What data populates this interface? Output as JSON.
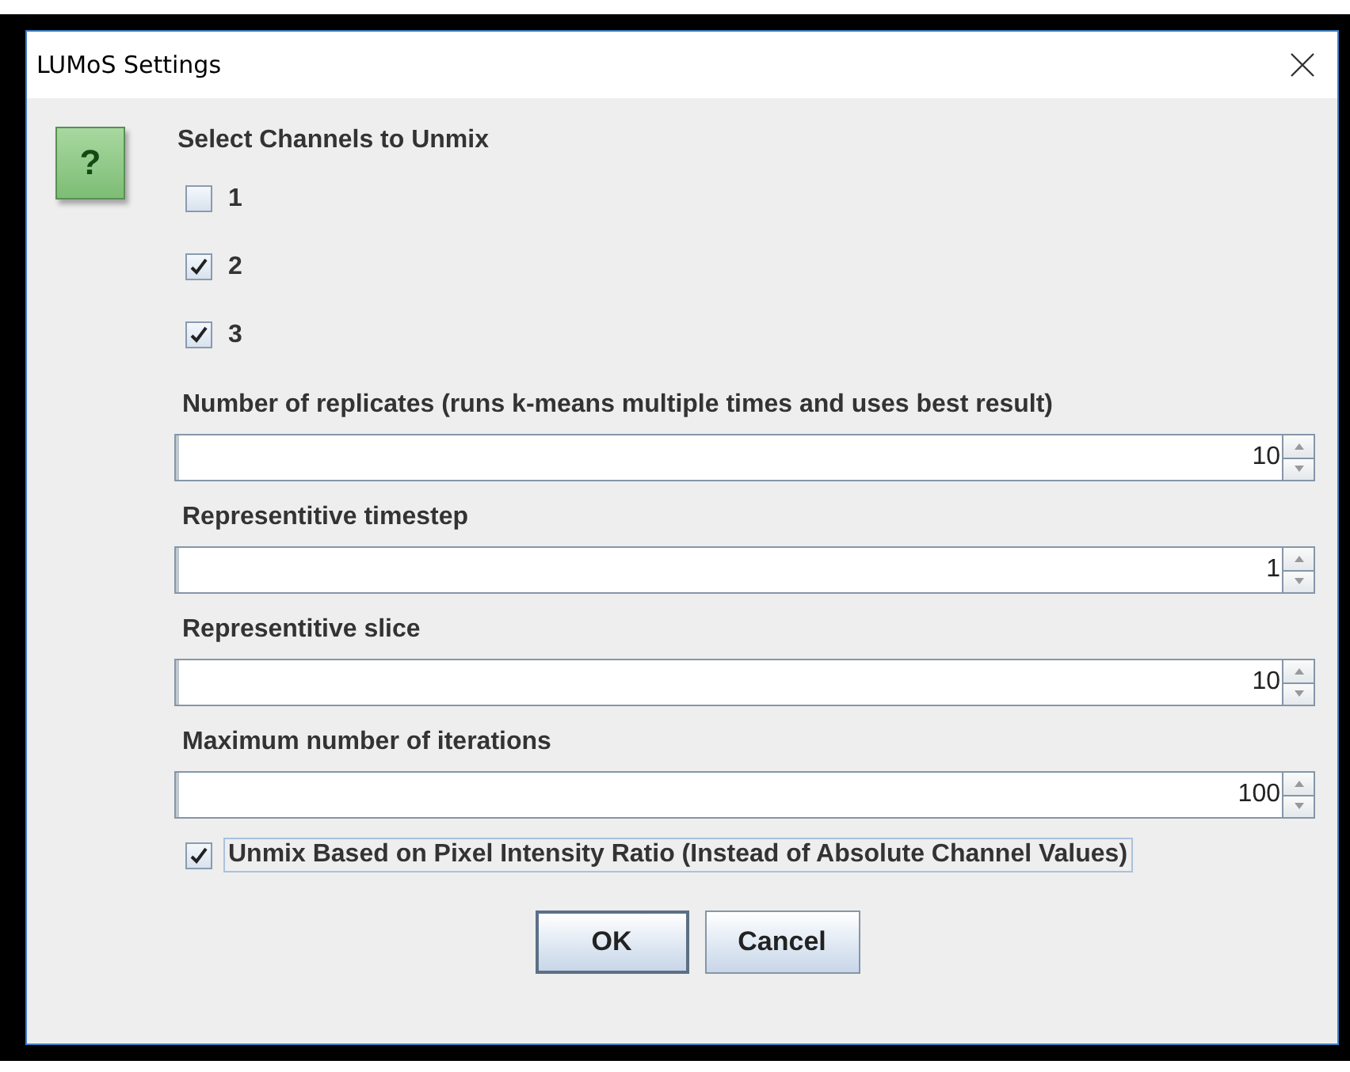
{
  "window": {
    "title": "LUMoS Settings"
  },
  "help_badge": "?",
  "channels": {
    "label": "Select Channels to Unmix",
    "options": [
      {
        "label": "1",
        "checked": false
      },
      {
        "label": "2",
        "checked": true
      },
      {
        "label": "3",
        "checked": true
      }
    ]
  },
  "fields": [
    {
      "label": "Number of replicates (runs k-means multiple times and uses best result)",
      "value": "10"
    },
    {
      "label": "Representitive timestep",
      "value": "1"
    },
    {
      "label": "Representitive slice",
      "value": "10"
    },
    {
      "label": "Maximum number of iterations",
      "value": "100"
    }
  ],
  "ratio_option": {
    "label": "Unmix Based on Pixel Intensity Ratio (Instead of Absolute Channel Values)",
    "checked": true,
    "focused": true
  },
  "buttons": [
    {
      "label": "OK",
      "default": true
    },
    {
      "label": "Cancel",
      "default": false
    }
  ]
}
